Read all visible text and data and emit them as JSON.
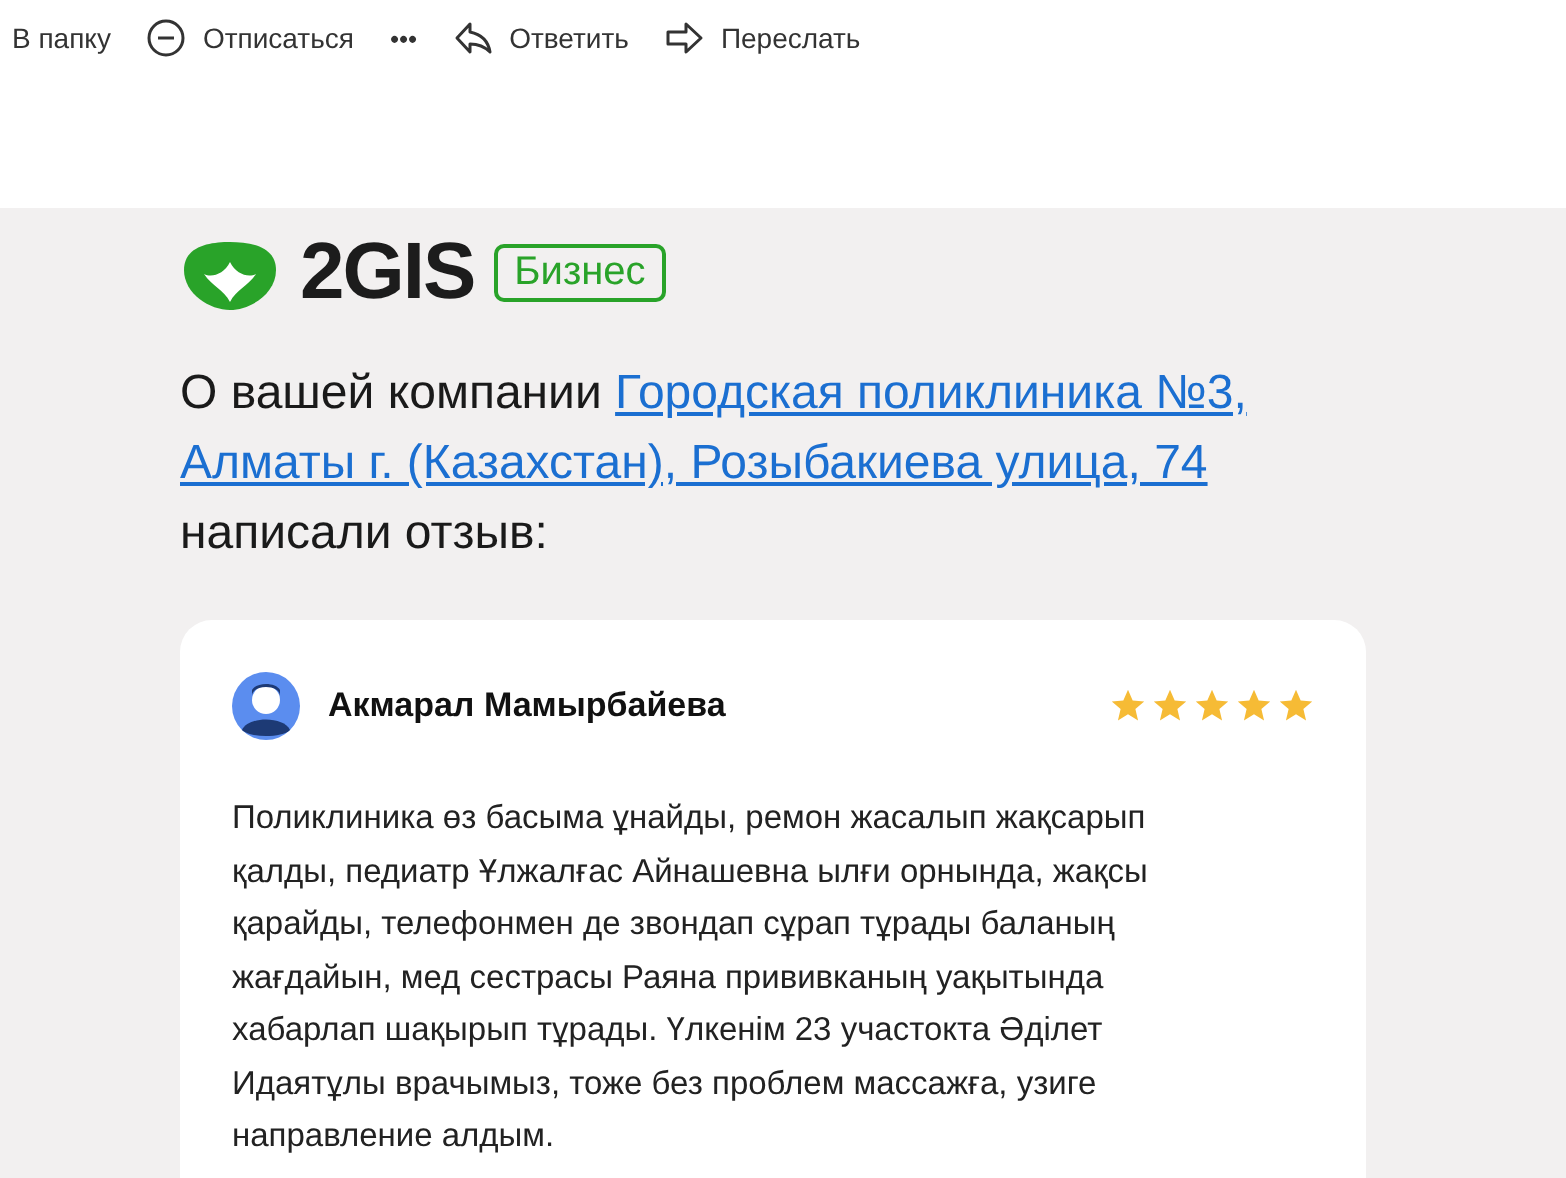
{
  "toolbar": [
    {
      "kind": "text",
      "label": "В папку"
    },
    {
      "kind": "unsubscribe",
      "label": "Отписаться"
    },
    {
      "kind": "more",
      "label": "•••"
    },
    {
      "kind": "reply",
      "label": "Ответить"
    },
    {
      "kind": "forward",
      "label": "Переслать"
    }
  ],
  "logo": {
    "wordmark": "2GIS",
    "badge": "Бизнес"
  },
  "heading": {
    "before": "О вашей компании",
    "link_lines": [
      "Городская поликлиника №3,",
      "Алматы г. (Казахстан), Розыбакиева улица, 74"
    ],
    "after": "написали отзыв:"
  },
  "review": {
    "author": "Акмарал Мамырбайева",
    "stars": 5,
    "text": "Поликлиника өз басыма ұнайды, ремон жасалып жақсарып қалды, педиатр Ұлжалғас Айнашевна ылғи орнында, жақсы қарайды, телефонмен де звондап сұрап тұрады баланың жағдайын, мед сестрасы Раяна прививканың уақытында хабарлап шақырып тұрады. Үлкенім 23 участокта Әділет Идаятұлы врачымыз, тоже без проблем массажға, узиге направление алдым."
  }
}
